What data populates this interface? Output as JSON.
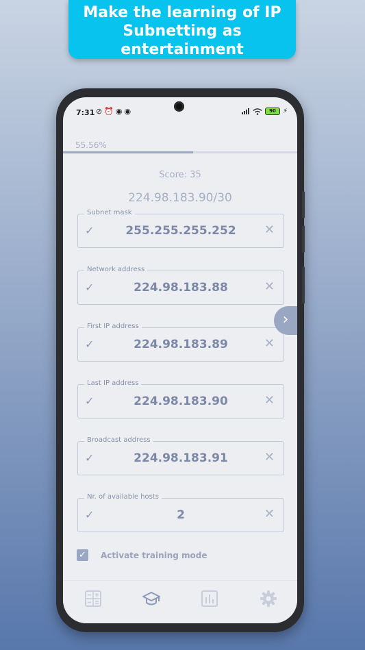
{
  "banner": {
    "line1": "Make the learning of IP",
    "line2": "Subnetting as",
    "line3": "entertainment"
  },
  "status_bar": {
    "time": "7:31",
    "battery": "90"
  },
  "progress": {
    "text": "55.56%",
    "value": 0.5556
  },
  "score": "Score: 35",
  "ip_cidr": "224.98.183.90/30",
  "fields": [
    {
      "label": "Subnet mask",
      "value": "255.255.255.252"
    },
    {
      "label": "Network address",
      "value": "224.98.183.88"
    },
    {
      "label": "First IP address",
      "value": "224.98.183.89"
    },
    {
      "label": "Last IP address",
      "value": "224.98.183.90"
    },
    {
      "label": "Broadcast address",
      "value": "224.98.183.91"
    },
    {
      "label": "Nr. of available hosts",
      "value": "2"
    }
  ],
  "training_mode": {
    "label": "Activate training mode",
    "checked": true
  },
  "bottom_nav": [
    {
      "icon": "calculator-icon",
      "active": false
    },
    {
      "icon": "graduation-cap-icon",
      "active": true
    },
    {
      "icon": "bar-chart-icon",
      "active": false
    },
    {
      "icon": "gear-icon",
      "active": false
    }
  ],
  "colors": {
    "banner": "#07c3ee",
    "accent": "#9aa7c3",
    "text_muted": "#a6afc4"
  }
}
